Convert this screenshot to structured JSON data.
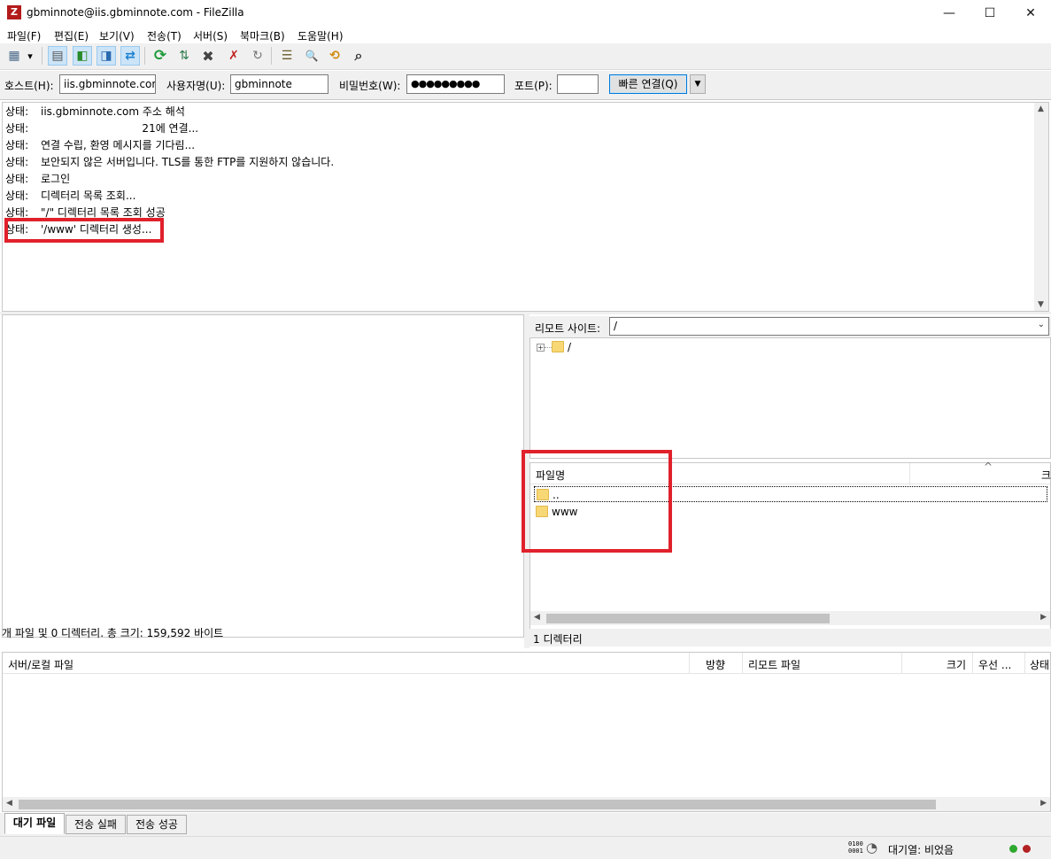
{
  "window": {
    "title": "gbminnote@iis.gbminnote.com - FileZilla",
    "app_icon_glyph": "Z",
    "minimize_glyph": "—",
    "maximize_glyph": "☐",
    "close_glyph": "✕"
  },
  "menu": {
    "items": [
      {
        "label": "파일(F)"
      },
      {
        "label": "편집(E)"
      },
      {
        "label": "보기(V)"
      },
      {
        "label": "전송(T)"
      },
      {
        "label": "서버(S)"
      },
      {
        "label": "북마크(B)"
      },
      {
        "label": "도움말(H)"
      }
    ]
  },
  "toolbar": {
    "icons": [
      {
        "name": "site-manager-icon",
        "glyph": "▦"
      },
      {
        "name": "site-manager-dropdown-icon",
        "glyph": "▾"
      },
      {
        "name": "toggle-message-log-icon",
        "glyph": "▤"
      },
      {
        "name": "toggle-local-tree-icon",
        "glyph": "◧"
      },
      {
        "name": "toggle-remote-tree-icon",
        "glyph": "◨"
      },
      {
        "name": "toggle-transfer-queue-icon",
        "glyph": "⇄"
      },
      {
        "name": "refresh-icon",
        "glyph": "⟳"
      },
      {
        "name": "process-queue-icon",
        "glyph": "⇅"
      },
      {
        "name": "cancel-operation-icon",
        "glyph": "✖"
      },
      {
        "name": "disconnect-icon",
        "glyph": "✗"
      },
      {
        "name": "reconnect-icon",
        "glyph": "↻"
      },
      {
        "name": "directory-filter-icon",
        "glyph": "☰"
      },
      {
        "name": "directory-comparison-icon",
        "glyph": "🔍"
      },
      {
        "name": "sync-browsing-icon",
        "glyph": "⟲"
      },
      {
        "name": "search-files-icon",
        "glyph": "⌕"
      }
    ],
    "accent_color": "#0078d7"
  },
  "quickconnect": {
    "host_label": "호스트(H):",
    "host_value": "iis.gbminnote.com",
    "user_label": "사용자명(U):",
    "user_value": "gbminnote",
    "password_label": "비밀번호(W):",
    "password_value": "●●●●●●●●●",
    "port_label": "포트(P):",
    "port_value": "",
    "connect_label": "빠른 연결(Q)",
    "dropdown_glyph": "▼"
  },
  "log": {
    "lines": [
      {
        "label": "상태:",
        "text": "iis.gbminnote.com 주소 해석"
      },
      {
        "label": "상태:",
        "text": "                              21에 연결..."
      },
      {
        "label": "상태:",
        "text": "연결 수립, 환영 메시지를 기다림..."
      },
      {
        "label": "상태:",
        "text": "보안되지 않은 서버입니다. TLS를 통한 FTP를 지원하지 않습니다."
      },
      {
        "label": "상태:",
        "text": "로그인"
      },
      {
        "label": "상태:",
        "text": "디렉터리 목록 조회..."
      },
      {
        "label": "상태:",
        "text": "\"/\" 디렉터리 목록 조회 성공"
      },
      {
        "label": "상태:",
        "text": "'/www' 디렉터리 생성..."
      }
    ]
  },
  "local": {
    "status_text": "개 파일 및 0 디렉터리. 총 크기: 159,592 바이트"
  },
  "remote": {
    "site_label": "리모트 사이트:",
    "site_path": "/",
    "tree_root": "/",
    "list_header_name": "파일명",
    "list_header_extra": "크",
    "sort_indicator": "^",
    "rows": [
      {
        "name": ".."
      },
      {
        "name": "www"
      }
    ],
    "status_text": "1 디렉터리"
  },
  "queue": {
    "columns": [
      "서버/로컬 파일",
      "방향",
      "리모트 파일",
      "크기",
      "우선 ...",
      "상태"
    ]
  },
  "tabs": [
    {
      "label": "대기 파일",
      "active": true
    },
    {
      "label": "전송 실패",
      "active": false
    },
    {
      "label": "전송 성공",
      "active": false
    }
  ],
  "statusbar": {
    "queue_text": "대기열: 비었음",
    "binary_glyph": "0100\n0001",
    "speed_glyph": "◔",
    "led_green": "#2fa82f",
    "led_red": "#b22222"
  },
  "annotations": {
    "highlight_color": "#e0212b"
  }
}
